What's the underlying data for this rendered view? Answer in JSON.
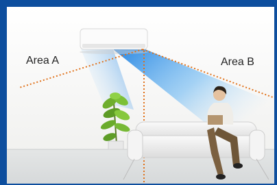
{
  "areas": {
    "a_label": "Area A",
    "b_label": "Area B"
  },
  "colors": {
    "frame_blue": "#0d4e9e",
    "wall": "#f7f7f5",
    "airflow": "#2f8fe6",
    "divider_lines": "#e07018"
  }
}
